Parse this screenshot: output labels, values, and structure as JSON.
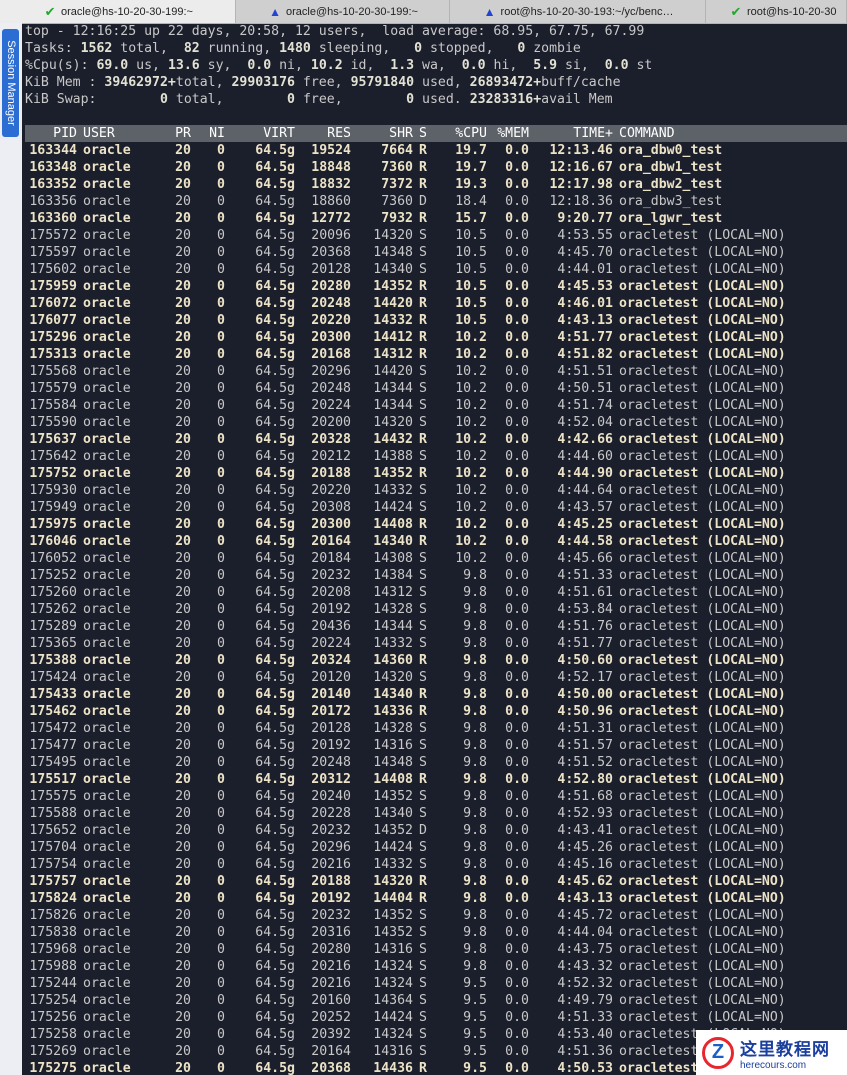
{
  "tabs": [
    {
      "title": "oracle@hs-10-20-30-199:~",
      "icon": "check-icon",
      "active": true
    },
    {
      "title": "oracle@hs-10-20-30-199:~",
      "icon": "warning-icon",
      "active": false
    },
    {
      "title": "root@hs-10-20-30-193:~/yc/benc…",
      "icon": "warning-icon",
      "active": false
    },
    {
      "title": "root@hs-10-20-30",
      "icon": "check-icon",
      "active": false
    }
  ],
  "sidebar": {
    "session_manager_label": "Session Manager"
  },
  "summary": {
    "line1": "top - 12:16:25 up 22 days, 20:58, 12 users,  load average: 68.95, 67.75, 67.99",
    "tasks_label": "Tasks: ",
    "tasks_total": "1562",
    "tasks_total_label": " total, ",
    "tasks_running": " 82",
    "tasks_running_label": " running, ",
    "tasks_sleeping": "1480",
    "tasks_sleeping_label": " sleeping, ",
    "tasks_stopped": "  0",
    "tasks_stopped_label": " stopped, ",
    "tasks_zombie": "  0",
    "tasks_zombie_label": " zombie",
    "cpu_label": "%Cpu(s): ",
    "cpu_us": "69.0",
    "cpu_us_label": " us, ",
    "cpu_sy": "13.6",
    "cpu_sy_label": " sy, ",
    "cpu_ni": " 0.0",
    "cpu_ni_label": " ni, ",
    "cpu_id": "10.2",
    "cpu_id_label": " id, ",
    "cpu_wa": " 1.3",
    "cpu_wa_label": " wa, ",
    "cpu_hi": " 0.0",
    "cpu_hi_label": " hi, ",
    "cpu_si": " 5.9",
    "cpu_si_label": " si, ",
    "cpu_st": " 0.0",
    "cpu_st_label": " st",
    "mem_label": "KiB Mem : ",
    "mem_total": "39462972+",
    "mem_total_label": "total, ",
    "mem_free": "29903176",
    "mem_free_label": " free, ",
    "mem_used": "95791840",
    "mem_used_label": " used, ",
    "mem_buff": "26893472+",
    "mem_buff_label": "buff/cache",
    "swap_label": "KiB Swap: ",
    "swap_total": "       0",
    "swap_total_label": " total, ",
    "swap_free": "       0",
    "swap_free_label": " free, ",
    "swap_used": "       0",
    "swap_used_label": " used. ",
    "swap_avail": "23283316+",
    "swap_avail_label": "avail Mem"
  },
  "columns": [
    "PID",
    "USER",
    "PR",
    "NI",
    "VIRT",
    "RES",
    "SHR",
    "S",
    "%CPU",
    "%MEM",
    "TIME+",
    "COMMAND"
  ],
  "processes": [
    {
      "pid": "163344",
      "user": "oracle",
      "pr": "20",
      "ni": "0",
      "virt": "64.5g",
      "res": "19524",
      "shr": "7664",
      "s": "R",
      "cpu": "19.7",
      "mem": "0.0",
      "time": "12:13.46",
      "cmd": "ora_dbw0_test",
      "bold": true
    },
    {
      "pid": "163348",
      "user": "oracle",
      "pr": "20",
      "ni": "0",
      "virt": "64.5g",
      "res": "18848",
      "shr": "7360",
      "s": "R",
      "cpu": "19.7",
      "mem": "0.0",
      "time": "12:16.67",
      "cmd": "ora_dbw1_test",
      "bold": true
    },
    {
      "pid": "163352",
      "user": "oracle",
      "pr": "20",
      "ni": "0",
      "virt": "64.5g",
      "res": "18832",
      "shr": "7372",
      "s": "R",
      "cpu": "19.3",
      "mem": "0.0",
      "time": "12:17.98",
      "cmd": "ora_dbw2_test",
      "bold": true
    },
    {
      "pid": "163356",
      "user": "oracle",
      "pr": "20",
      "ni": "0",
      "virt": "64.5g",
      "res": "18860",
      "shr": "7360",
      "s": "D",
      "cpu": "18.4",
      "mem": "0.0",
      "time": "12:18.36",
      "cmd": "ora_dbw3_test",
      "bold": false
    },
    {
      "pid": "163360",
      "user": "oracle",
      "pr": "20",
      "ni": "0",
      "virt": "64.5g",
      "res": "12772",
      "shr": "7932",
      "s": "R",
      "cpu": "15.7",
      "mem": "0.0",
      "time": "9:20.77",
      "cmd": "ora_lgwr_test",
      "bold": true
    },
    {
      "pid": "175572",
      "user": "oracle",
      "pr": "20",
      "ni": "0",
      "virt": "64.5g",
      "res": "20096",
      "shr": "14320",
      "s": "S",
      "cpu": "10.5",
      "mem": "0.0",
      "time": "4:53.55",
      "cmd": "oracletest (LOCAL=NO)",
      "bold": false
    },
    {
      "pid": "175597",
      "user": "oracle",
      "pr": "20",
      "ni": "0",
      "virt": "64.5g",
      "res": "20368",
      "shr": "14348",
      "s": "S",
      "cpu": "10.5",
      "mem": "0.0",
      "time": "4:45.70",
      "cmd": "oracletest (LOCAL=NO)",
      "bold": false
    },
    {
      "pid": "175602",
      "user": "oracle",
      "pr": "20",
      "ni": "0",
      "virt": "64.5g",
      "res": "20128",
      "shr": "14340",
      "s": "S",
      "cpu": "10.5",
      "mem": "0.0",
      "time": "4:44.01",
      "cmd": "oracletest (LOCAL=NO)",
      "bold": false
    },
    {
      "pid": "175959",
      "user": "oracle",
      "pr": "20",
      "ni": "0",
      "virt": "64.5g",
      "res": "20280",
      "shr": "14352",
      "s": "R",
      "cpu": "10.5",
      "mem": "0.0",
      "time": "4:45.53",
      "cmd": "oracletest (LOCAL=NO)",
      "bold": true
    },
    {
      "pid": "176072",
      "user": "oracle",
      "pr": "20",
      "ni": "0",
      "virt": "64.5g",
      "res": "20248",
      "shr": "14420",
      "s": "R",
      "cpu": "10.5",
      "mem": "0.0",
      "time": "4:46.01",
      "cmd": "oracletest (LOCAL=NO)",
      "bold": true
    },
    {
      "pid": "176077",
      "user": "oracle",
      "pr": "20",
      "ni": "0",
      "virt": "64.5g",
      "res": "20220",
      "shr": "14332",
      "s": "R",
      "cpu": "10.5",
      "mem": "0.0",
      "time": "4:43.13",
      "cmd": "oracletest (LOCAL=NO)",
      "bold": true
    },
    {
      "pid": "175296",
      "user": "oracle",
      "pr": "20",
      "ni": "0",
      "virt": "64.5g",
      "res": "20300",
      "shr": "14412",
      "s": "R",
      "cpu": "10.2",
      "mem": "0.0",
      "time": "4:51.77",
      "cmd": "oracletest (LOCAL=NO)",
      "bold": true
    },
    {
      "pid": "175313",
      "user": "oracle",
      "pr": "20",
      "ni": "0",
      "virt": "64.5g",
      "res": "20168",
      "shr": "14312",
      "s": "R",
      "cpu": "10.2",
      "mem": "0.0",
      "time": "4:51.82",
      "cmd": "oracletest (LOCAL=NO)",
      "bold": true
    },
    {
      "pid": "175568",
      "user": "oracle",
      "pr": "20",
      "ni": "0",
      "virt": "64.5g",
      "res": "20296",
      "shr": "14420",
      "s": "S",
      "cpu": "10.2",
      "mem": "0.0",
      "time": "4:51.51",
      "cmd": "oracletest (LOCAL=NO)",
      "bold": false
    },
    {
      "pid": "175579",
      "user": "oracle",
      "pr": "20",
      "ni": "0",
      "virt": "64.5g",
      "res": "20248",
      "shr": "14344",
      "s": "S",
      "cpu": "10.2",
      "mem": "0.0",
      "time": "4:50.51",
      "cmd": "oracletest (LOCAL=NO)",
      "bold": false
    },
    {
      "pid": "175584",
      "user": "oracle",
      "pr": "20",
      "ni": "0",
      "virt": "64.5g",
      "res": "20224",
      "shr": "14344",
      "s": "S",
      "cpu": "10.2",
      "mem": "0.0",
      "time": "4:51.74",
      "cmd": "oracletest (LOCAL=NO)",
      "bold": false
    },
    {
      "pid": "175590",
      "user": "oracle",
      "pr": "20",
      "ni": "0",
      "virt": "64.5g",
      "res": "20200",
      "shr": "14320",
      "s": "S",
      "cpu": "10.2",
      "mem": "0.0",
      "time": "4:52.04",
      "cmd": "oracletest (LOCAL=NO)",
      "bold": false
    },
    {
      "pid": "175637",
      "user": "oracle",
      "pr": "20",
      "ni": "0",
      "virt": "64.5g",
      "res": "20328",
      "shr": "14432",
      "s": "R",
      "cpu": "10.2",
      "mem": "0.0",
      "time": "4:42.66",
      "cmd": "oracletest (LOCAL=NO)",
      "bold": true
    },
    {
      "pid": "175642",
      "user": "oracle",
      "pr": "20",
      "ni": "0",
      "virt": "64.5g",
      "res": "20212",
      "shr": "14388",
      "s": "S",
      "cpu": "10.2",
      "mem": "0.0",
      "time": "4:44.60",
      "cmd": "oracletest (LOCAL=NO)",
      "bold": false
    },
    {
      "pid": "175752",
      "user": "oracle",
      "pr": "20",
      "ni": "0",
      "virt": "64.5g",
      "res": "20188",
      "shr": "14352",
      "s": "R",
      "cpu": "10.2",
      "mem": "0.0",
      "time": "4:44.90",
      "cmd": "oracletest (LOCAL=NO)",
      "bold": true
    },
    {
      "pid": "175930",
      "user": "oracle",
      "pr": "20",
      "ni": "0",
      "virt": "64.5g",
      "res": "20220",
      "shr": "14332",
      "s": "S",
      "cpu": "10.2",
      "mem": "0.0",
      "time": "4:44.64",
      "cmd": "oracletest (LOCAL=NO)",
      "bold": false
    },
    {
      "pid": "175949",
      "user": "oracle",
      "pr": "20",
      "ni": "0",
      "virt": "64.5g",
      "res": "20308",
      "shr": "14424",
      "s": "S",
      "cpu": "10.2",
      "mem": "0.0",
      "time": "4:43.57",
      "cmd": "oracletest (LOCAL=NO)",
      "bold": false
    },
    {
      "pid": "175975",
      "user": "oracle",
      "pr": "20",
      "ni": "0",
      "virt": "64.5g",
      "res": "20300",
      "shr": "14408",
      "s": "R",
      "cpu": "10.2",
      "mem": "0.0",
      "time": "4:45.25",
      "cmd": "oracletest (LOCAL=NO)",
      "bold": true
    },
    {
      "pid": "176046",
      "user": "oracle",
      "pr": "20",
      "ni": "0",
      "virt": "64.5g",
      "res": "20164",
      "shr": "14340",
      "s": "R",
      "cpu": "10.2",
      "mem": "0.0",
      "time": "4:44.58",
      "cmd": "oracletest (LOCAL=NO)",
      "bold": true
    },
    {
      "pid": "176052",
      "user": "oracle",
      "pr": "20",
      "ni": "0",
      "virt": "64.5g",
      "res": "20184",
      "shr": "14308",
      "s": "S",
      "cpu": "10.2",
      "mem": "0.0",
      "time": "4:45.66",
      "cmd": "oracletest (LOCAL=NO)",
      "bold": false
    },
    {
      "pid": "175252",
      "user": "oracle",
      "pr": "20",
      "ni": "0",
      "virt": "64.5g",
      "res": "20232",
      "shr": "14384",
      "s": "S",
      "cpu": "9.8",
      "mem": "0.0",
      "time": "4:51.33",
      "cmd": "oracletest (LOCAL=NO)",
      "bold": false
    },
    {
      "pid": "175260",
      "user": "oracle",
      "pr": "20",
      "ni": "0",
      "virt": "64.5g",
      "res": "20208",
      "shr": "14312",
      "s": "S",
      "cpu": "9.8",
      "mem": "0.0",
      "time": "4:51.61",
      "cmd": "oracletest (LOCAL=NO)",
      "bold": false
    },
    {
      "pid": "175262",
      "user": "oracle",
      "pr": "20",
      "ni": "0",
      "virt": "64.5g",
      "res": "20192",
      "shr": "14328",
      "s": "S",
      "cpu": "9.8",
      "mem": "0.0",
      "time": "4:53.84",
      "cmd": "oracletest (LOCAL=NO)",
      "bold": false
    },
    {
      "pid": "175289",
      "user": "oracle",
      "pr": "20",
      "ni": "0",
      "virt": "64.5g",
      "res": "20436",
      "shr": "14344",
      "s": "S",
      "cpu": "9.8",
      "mem": "0.0",
      "time": "4:51.76",
      "cmd": "oracletest (LOCAL=NO)",
      "bold": false
    },
    {
      "pid": "175365",
      "user": "oracle",
      "pr": "20",
      "ni": "0",
      "virt": "64.5g",
      "res": "20224",
      "shr": "14332",
      "s": "S",
      "cpu": "9.8",
      "mem": "0.0",
      "time": "4:51.77",
      "cmd": "oracletest (LOCAL=NO)",
      "bold": false
    },
    {
      "pid": "175388",
      "user": "oracle",
      "pr": "20",
      "ni": "0",
      "virt": "64.5g",
      "res": "20324",
      "shr": "14360",
      "s": "R",
      "cpu": "9.8",
      "mem": "0.0",
      "time": "4:50.60",
      "cmd": "oracletest (LOCAL=NO)",
      "bold": true
    },
    {
      "pid": "175424",
      "user": "oracle",
      "pr": "20",
      "ni": "0",
      "virt": "64.5g",
      "res": "20120",
      "shr": "14320",
      "s": "S",
      "cpu": "9.8",
      "mem": "0.0",
      "time": "4:52.17",
      "cmd": "oracletest (LOCAL=NO)",
      "bold": false
    },
    {
      "pid": "175433",
      "user": "oracle",
      "pr": "20",
      "ni": "0",
      "virt": "64.5g",
      "res": "20140",
      "shr": "14340",
      "s": "R",
      "cpu": "9.8",
      "mem": "0.0",
      "time": "4:50.00",
      "cmd": "oracletest (LOCAL=NO)",
      "bold": true
    },
    {
      "pid": "175462",
      "user": "oracle",
      "pr": "20",
      "ni": "0",
      "virt": "64.5g",
      "res": "20172",
      "shr": "14336",
      "s": "R",
      "cpu": "9.8",
      "mem": "0.0",
      "time": "4:50.96",
      "cmd": "oracletest (LOCAL=NO)",
      "bold": true
    },
    {
      "pid": "175472",
      "user": "oracle",
      "pr": "20",
      "ni": "0",
      "virt": "64.5g",
      "res": "20128",
      "shr": "14328",
      "s": "S",
      "cpu": "9.8",
      "mem": "0.0",
      "time": "4:51.31",
      "cmd": "oracletest (LOCAL=NO)",
      "bold": false
    },
    {
      "pid": "175477",
      "user": "oracle",
      "pr": "20",
      "ni": "0",
      "virt": "64.5g",
      "res": "20192",
      "shr": "14316",
      "s": "S",
      "cpu": "9.8",
      "mem": "0.0",
      "time": "4:51.57",
      "cmd": "oracletest (LOCAL=NO)",
      "bold": false
    },
    {
      "pid": "175495",
      "user": "oracle",
      "pr": "20",
      "ni": "0",
      "virt": "64.5g",
      "res": "20248",
      "shr": "14348",
      "s": "S",
      "cpu": "9.8",
      "mem": "0.0",
      "time": "4:51.52",
      "cmd": "oracletest (LOCAL=NO)",
      "bold": false
    },
    {
      "pid": "175517",
      "user": "oracle",
      "pr": "20",
      "ni": "0",
      "virt": "64.5g",
      "res": "20312",
      "shr": "14408",
      "s": "R",
      "cpu": "9.8",
      "mem": "0.0",
      "time": "4:52.80",
      "cmd": "oracletest (LOCAL=NO)",
      "bold": true
    },
    {
      "pid": "175575",
      "user": "oracle",
      "pr": "20",
      "ni": "0",
      "virt": "64.5g",
      "res": "20240",
      "shr": "14352",
      "s": "S",
      "cpu": "9.8",
      "mem": "0.0",
      "time": "4:51.68",
      "cmd": "oracletest (LOCAL=NO)",
      "bold": false
    },
    {
      "pid": "175588",
      "user": "oracle",
      "pr": "20",
      "ni": "0",
      "virt": "64.5g",
      "res": "20228",
      "shr": "14340",
      "s": "S",
      "cpu": "9.8",
      "mem": "0.0",
      "time": "4:52.93",
      "cmd": "oracletest (LOCAL=NO)",
      "bold": false
    },
    {
      "pid": "175652",
      "user": "oracle",
      "pr": "20",
      "ni": "0",
      "virt": "64.5g",
      "res": "20232",
      "shr": "14352",
      "s": "D",
      "cpu": "9.8",
      "mem": "0.0",
      "time": "4:43.41",
      "cmd": "oracletest (LOCAL=NO)",
      "bold": false
    },
    {
      "pid": "175704",
      "user": "oracle",
      "pr": "20",
      "ni": "0",
      "virt": "64.5g",
      "res": "20296",
      "shr": "14424",
      "s": "S",
      "cpu": "9.8",
      "mem": "0.0",
      "time": "4:45.26",
      "cmd": "oracletest (LOCAL=NO)",
      "bold": false
    },
    {
      "pid": "175754",
      "user": "oracle",
      "pr": "20",
      "ni": "0",
      "virt": "64.5g",
      "res": "20216",
      "shr": "14332",
      "s": "S",
      "cpu": "9.8",
      "mem": "0.0",
      "time": "4:45.16",
      "cmd": "oracletest (LOCAL=NO)",
      "bold": false
    },
    {
      "pid": "175757",
      "user": "oracle",
      "pr": "20",
      "ni": "0",
      "virt": "64.5g",
      "res": "20188",
      "shr": "14320",
      "s": "R",
      "cpu": "9.8",
      "mem": "0.0",
      "time": "4:45.62",
      "cmd": "oracletest (LOCAL=NO)",
      "bold": true
    },
    {
      "pid": "175824",
      "user": "oracle",
      "pr": "20",
      "ni": "0",
      "virt": "64.5g",
      "res": "20192",
      "shr": "14404",
      "s": "R",
      "cpu": "9.8",
      "mem": "0.0",
      "time": "4:43.13",
      "cmd": "oracletest (LOCAL=NO)",
      "bold": true
    },
    {
      "pid": "175826",
      "user": "oracle",
      "pr": "20",
      "ni": "0",
      "virt": "64.5g",
      "res": "20232",
      "shr": "14352",
      "s": "S",
      "cpu": "9.8",
      "mem": "0.0",
      "time": "4:45.72",
      "cmd": "oracletest (LOCAL=NO)",
      "bold": false
    },
    {
      "pid": "175838",
      "user": "oracle",
      "pr": "20",
      "ni": "0",
      "virt": "64.5g",
      "res": "20316",
      "shr": "14352",
      "s": "S",
      "cpu": "9.8",
      "mem": "0.0",
      "time": "4:44.04",
      "cmd": "oracletest (LOCAL=NO)",
      "bold": false
    },
    {
      "pid": "175968",
      "user": "oracle",
      "pr": "20",
      "ni": "0",
      "virt": "64.5g",
      "res": "20280",
      "shr": "14316",
      "s": "S",
      "cpu": "9.8",
      "mem": "0.0",
      "time": "4:43.75",
      "cmd": "oracletest (LOCAL=NO)",
      "bold": false
    },
    {
      "pid": "175988",
      "user": "oracle",
      "pr": "20",
      "ni": "0",
      "virt": "64.5g",
      "res": "20216",
      "shr": "14324",
      "s": "S",
      "cpu": "9.8",
      "mem": "0.0",
      "time": "4:43.32",
      "cmd": "oracletest (LOCAL=NO)",
      "bold": false
    },
    {
      "pid": "175244",
      "user": "oracle",
      "pr": "20",
      "ni": "0",
      "virt": "64.5g",
      "res": "20216",
      "shr": "14324",
      "s": "S",
      "cpu": "9.5",
      "mem": "0.0",
      "time": "4:52.32",
      "cmd": "oracletest (LOCAL=NO)",
      "bold": false
    },
    {
      "pid": "175254",
      "user": "oracle",
      "pr": "20",
      "ni": "0",
      "virt": "64.5g",
      "res": "20160",
      "shr": "14364",
      "s": "S",
      "cpu": "9.5",
      "mem": "0.0",
      "time": "4:49.79",
      "cmd": "oracletest (LOCAL=NO)",
      "bold": false
    },
    {
      "pid": "175256",
      "user": "oracle",
      "pr": "20",
      "ni": "0",
      "virt": "64.5g",
      "res": "20252",
      "shr": "14424",
      "s": "S",
      "cpu": "9.5",
      "mem": "0.0",
      "time": "4:51.33",
      "cmd": "oracletest (LOCAL=NO)",
      "bold": false
    },
    {
      "pid": "175258",
      "user": "oracle",
      "pr": "20",
      "ni": "0",
      "virt": "64.5g",
      "res": "20392",
      "shr": "14324",
      "s": "S",
      "cpu": "9.5",
      "mem": "0.0",
      "time": "4:53.40",
      "cmd": "oracletest (LOCAL=NO)",
      "bold": false
    },
    {
      "pid": "175269",
      "user": "oracle",
      "pr": "20",
      "ni": "0",
      "virt": "64.5g",
      "res": "20164",
      "shr": "14316",
      "s": "S",
      "cpu": "9.5",
      "mem": "0.0",
      "time": "4:51.36",
      "cmd": "oracletest (LOCAL=NO)",
      "bold": false
    },
    {
      "pid": "175275",
      "user": "oracle",
      "pr": "20",
      "ni": "0",
      "virt": "64.5g",
      "res": "20368",
      "shr": "14436",
      "s": "R",
      "cpu": "9.5",
      "mem": "0.0",
      "time": "4:50.53",
      "cmd": "oracletest",
      "bold": true
    }
  ],
  "watermark": {
    "title": "这里教程网",
    "url": "herecours.com",
    "logo_letter": "Z"
  }
}
